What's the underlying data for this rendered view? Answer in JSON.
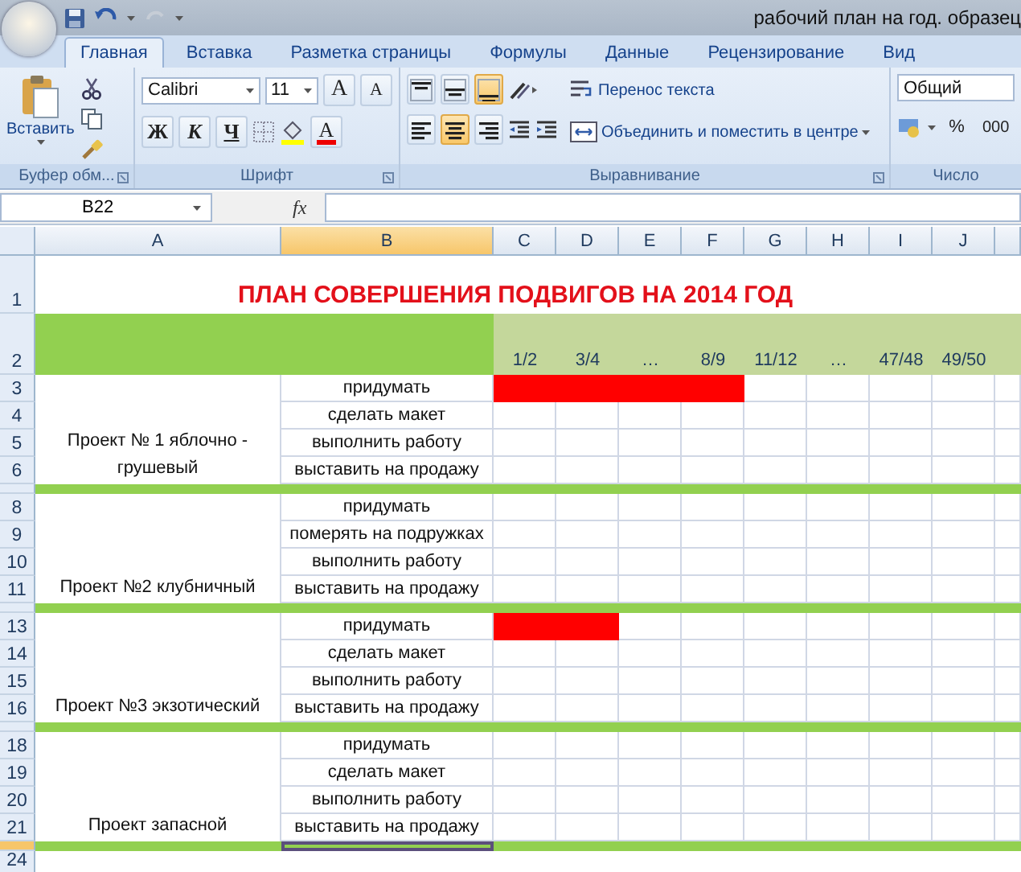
{
  "window": {
    "title": "рабочий план на год. образец"
  },
  "tabs": [
    {
      "label": "Главная",
      "selected": true
    },
    {
      "label": "Вставка",
      "selected": false
    },
    {
      "label": "Разметка страницы",
      "selected": false
    },
    {
      "label": "Формулы",
      "selected": false
    },
    {
      "label": "Данные",
      "selected": false
    },
    {
      "label": "Рецензирование",
      "selected": false
    },
    {
      "label": "Вид",
      "selected": false
    }
  ],
  "ribbon": {
    "clipboard": {
      "label": "Буфер обм...",
      "paste": "Вставить"
    },
    "font": {
      "label": "Шрифт",
      "name": "Calibri",
      "size": "11",
      "grow": "A",
      "shrink": "A",
      "bold": "Ж",
      "italic": "К",
      "underline": "Ч",
      "font_color": "A"
    },
    "alignment": {
      "label": "Выравнивание",
      "vertical": [
        {
          "kind": "top",
          "selected": false
        },
        {
          "kind": "middle",
          "selected": false
        },
        {
          "kind": "bottom",
          "selected": true
        }
      ],
      "horizontal": [
        {
          "kind": "left",
          "selected": false
        },
        {
          "kind": "center",
          "selected": true
        },
        {
          "kind": "right",
          "selected": false
        }
      ],
      "wrap": "Перенос текста",
      "merge": "Объединить и поместить в центре"
    },
    "number": {
      "label": "Число",
      "format": "Общий",
      "percent": "%",
      "thousands": "000"
    }
  },
  "formula_bar": {
    "name_box": "B22",
    "fx": "fx"
  },
  "sheet": {
    "columns": [
      {
        "label": "A",
        "selected": false
      },
      {
        "label": "B",
        "selected": true
      },
      {
        "label": "C",
        "selected": false
      },
      {
        "label": "D",
        "selected": false
      },
      {
        "label": "E",
        "selected": false
      },
      {
        "label": "F",
        "selected": false
      },
      {
        "label": "G",
        "selected": false
      },
      {
        "label": "H",
        "selected": false
      },
      {
        "label": "I",
        "selected": false
      },
      {
        "label": "J",
        "selected": false
      }
    ],
    "title_row": "1",
    "title": "ПЛАН СОВЕРШЕНИЯ ПОДВИГОВ НА 2014 ГОД",
    "period_row": "2",
    "periods": [
      "1/2",
      "3/4",
      "…",
      "8/9",
      "11/12",
      "…",
      "47/48",
      "49/50"
    ],
    "projects": [
      {
        "name": "Проект № 1 яблочно - грушевый",
        "separator_selected": false,
        "tasks": [
          {
            "row": "3",
            "label": "придумать",
            "timeline": [
              true,
              true,
              true,
              true,
              false,
              false,
              false,
              false
            ]
          },
          {
            "row": "4",
            "label": "сделать макет",
            "timeline": [
              false,
              false,
              false,
              false,
              false,
              false,
              false,
              false
            ]
          },
          {
            "row": "5",
            "label": "выполнить работу",
            "timeline": [
              false,
              false,
              false,
              false,
              false,
              false,
              false,
              false
            ]
          },
          {
            "row": "6",
            "label": "выставить на продажу",
            "timeline": [
              false,
              false,
              false,
              false,
              false,
              false,
              false,
              false
            ]
          }
        ]
      },
      {
        "name": "Проект №2 клубничный",
        "separator_selected": false,
        "tasks": [
          {
            "row": "8",
            "label": "придумать",
            "timeline": [
              false,
              false,
              false,
              false,
              false,
              false,
              false,
              false
            ]
          },
          {
            "row": "9",
            "label": "померять на подружках",
            "timeline": [
              false,
              false,
              false,
              false,
              false,
              false,
              false,
              false
            ]
          },
          {
            "row": "10",
            "label": "выполнить работу",
            "timeline": [
              false,
              false,
              false,
              false,
              false,
              false,
              false,
              false
            ]
          },
          {
            "row": "11",
            "label": "выставить на продажу",
            "timeline": [
              false,
              false,
              false,
              false,
              false,
              false,
              false,
              false
            ]
          }
        ]
      },
      {
        "name": "Проект №3 экзотический",
        "separator_selected": false,
        "tasks": [
          {
            "row": "13",
            "label": "придумать",
            "timeline": [
              true,
              true,
              false,
              false,
              false,
              false,
              false,
              false
            ]
          },
          {
            "row": "14",
            "label": "сделать макет",
            "timeline": [
              false,
              false,
              false,
              false,
              false,
              false,
              false,
              false
            ]
          },
          {
            "row": "15",
            "label": "выполнить работу",
            "timeline": [
              false,
              false,
              false,
              false,
              false,
              false,
              false,
              false
            ]
          },
          {
            "row": "16",
            "label": "выставить на продажу",
            "timeline": [
              false,
              false,
              false,
              false,
              false,
              false,
              false,
              false
            ]
          }
        ]
      },
      {
        "name": "Проект запасной",
        "separator_selected": true,
        "tasks": [
          {
            "row": "18",
            "label": "придумать",
            "timeline": [
              false,
              false,
              false,
              false,
              false,
              false,
              false,
              false
            ]
          },
          {
            "row": "19",
            "label": "сделать макет",
            "timeline": [
              false,
              false,
              false,
              false,
              false,
              false,
              false,
              false
            ]
          },
          {
            "row": "20",
            "label": "выполнить работу",
            "timeline": [
              false,
              false,
              false,
              false,
              false,
              false,
              false,
              false
            ]
          },
          {
            "row": "21",
            "label": "выставить на продажу",
            "timeline": [
              false,
              false,
              false,
              false,
              false,
              false,
              false,
              false
            ]
          }
        ]
      }
    ],
    "last_row": "24"
  }
}
